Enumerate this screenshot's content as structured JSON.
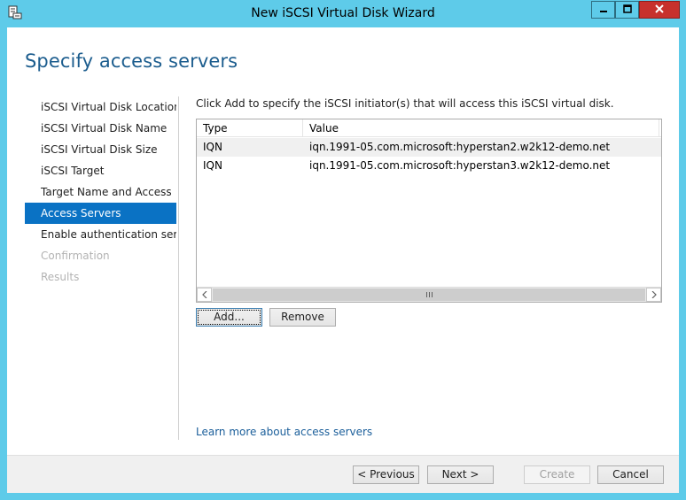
{
  "window": {
    "title": "New iSCSI Virtual Disk Wizard",
    "icons": {
      "app": "wizard-app-icon",
      "minimize": "minimize-icon",
      "maximize": "maximize-icon",
      "close": "close-icon"
    }
  },
  "page": {
    "title": "Specify access servers",
    "instructions": "Click Add to specify the iSCSI initiator(s) that will access this iSCSI virtual disk.",
    "learn_more": "Learn more about access servers"
  },
  "nav": {
    "items": [
      {
        "label": "iSCSI Virtual Disk Location",
        "state": "normal"
      },
      {
        "label": "iSCSI Virtual Disk Name",
        "state": "normal"
      },
      {
        "label": "iSCSI Virtual Disk Size",
        "state": "normal"
      },
      {
        "label": "iSCSI Target",
        "state": "normal"
      },
      {
        "label": "Target Name and Access",
        "state": "normal"
      },
      {
        "label": "Access Servers",
        "state": "selected"
      },
      {
        "label": "Enable authentication ser...",
        "state": "normal"
      },
      {
        "label": "Confirmation",
        "state": "disabled"
      },
      {
        "label": "Results",
        "state": "disabled"
      }
    ]
  },
  "table": {
    "columns": [
      "Type",
      "Value"
    ],
    "rows": [
      [
        "IQN",
        "iqn.1991-05.com.microsoft:hyperstan2.w2k12-demo.net"
      ],
      [
        "IQN",
        "iqn.1991-05.com.microsoft:hyperstan3.w2k12-demo.net"
      ]
    ]
  },
  "buttons": {
    "add": "Add...",
    "remove": "Remove",
    "previous": "< Previous",
    "next": "Next >",
    "create": "Create",
    "cancel": "Cancel"
  },
  "colors": {
    "accent": "#0a72c4",
    "title_blue": "#1c5d8e",
    "frame": "#5ecbe9",
    "close_red": "#c7312d"
  }
}
